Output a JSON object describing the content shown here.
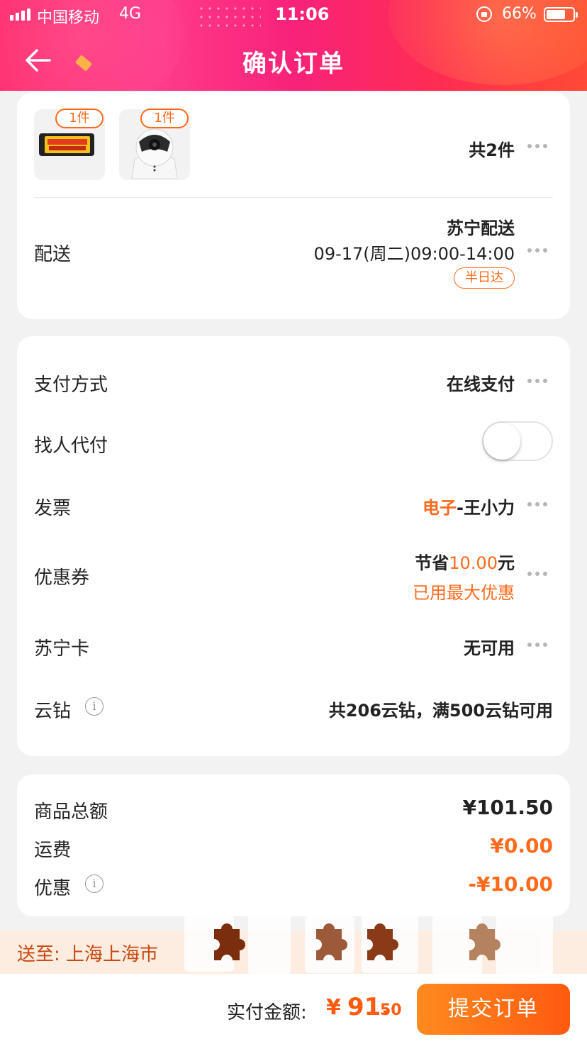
{
  "status_bar": {
    "carrier": "中国移动",
    "network": "4G",
    "time": "11:06",
    "battery": "66%"
  },
  "header": {
    "title": "确认订单",
    "back_icon": "arrow-left-icon"
  },
  "order_items": {
    "items": [
      {
        "qty": "1件",
        "image": "trash-bag-product-image"
      },
      {
        "qty": "1件",
        "image": "security-camera-product-image"
      }
    ],
    "count_text": "共2件"
  },
  "delivery": {
    "label": "配送",
    "provider": "苏宁配送",
    "time_slot": "09-17(周二)09:00-14:00",
    "badge": "半日达"
  },
  "payment": {
    "method_label": "支付方式",
    "method_value": "在线支付",
    "proxy_label": "找人代付",
    "proxy_enabled": false,
    "invoice_label": "发票",
    "invoice_type": "电子",
    "invoice_rest": "-王小力",
    "coupon_label": "优惠券",
    "coupon_prefix": "节省",
    "coupon_amount": "10.00",
    "coupon_suffix": "元",
    "coupon_note": "已用最大优惠",
    "card_label": "苏宁卡",
    "card_value": "无可用",
    "diamond_label": "云钻",
    "diamond_value": "共206云钻，满500云钻可用"
  },
  "summary": {
    "goods_label": "商品总额",
    "goods_value": "¥101.50",
    "shipping_label": "运费",
    "shipping_value": "¥0.00",
    "discount_label": "优惠",
    "discount_value": "-¥10.00"
  },
  "address": {
    "text": "送至: 上海上海市"
  },
  "bottom": {
    "pay_label": "实付金额:",
    "currency": "¥",
    "amount_int": "91.",
    "amount_dec": "50",
    "submit_label": "提交订单"
  },
  "colors": {
    "accent": "#ff6a1a",
    "header_pink": "#f8227a",
    "header_red": "#ff4a35",
    "submit_orange": "#ff5a10"
  }
}
